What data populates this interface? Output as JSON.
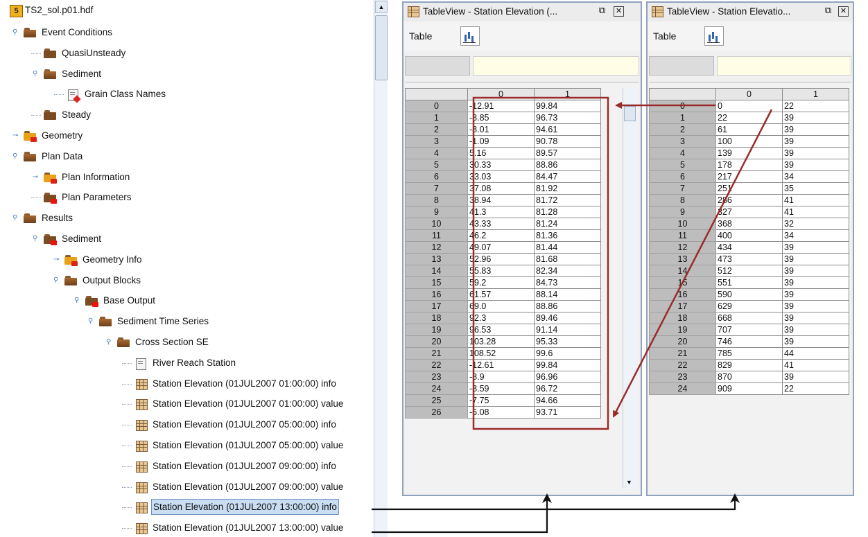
{
  "tree": {
    "root": "TS2_sol.p01.hdf",
    "items": [
      {
        "label": "Event Conditions",
        "icon": "folder-open-icon"
      },
      {
        "label": "QuasiUnsteady",
        "icon": "folder-icon"
      },
      {
        "label": "Sediment",
        "icon": "folder-open-icon"
      },
      {
        "label": "Grain Class Names",
        "icon": "dataset-icon"
      },
      {
        "label": "Steady",
        "icon": "folder-icon"
      },
      {
        "label": "Geometry",
        "icon": "folder-special-icon"
      },
      {
        "label": "Plan Data",
        "icon": "folder-open-icon"
      },
      {
        "label": "Plan Information",
        "icon": "folder-special-icon"
      },
      {
        "label": "Plan Parameters",
        "icon": "folder-red-icon"
      },
      {
        "label": "Results",
        "icon": "folder-open-icon"
      },
      {
        "label": "Sediment",
        "icon": "folder-red-icon"
      },
      {
        "label": "Geometry Info",
        "icon": "folder-special-icon"
      },
      {
        "label": "Output Blocks",
        "icon": "folder-open-icon"
      },
      {
        "label": "Base Output",
        "icon": "folder-red-icon"
      },
      {
        "label": "Sediment Time Series",
        "icon": "folder-open-icon"
      },
      {
        "label": "Cross Section SE",
        "icon": "folder-open-icon"
      },
      {
        "label": "River Reach Station",
        "icon": "document-icon"
      },
      {
        "label": "Station Elevation (01JUL2007 01:00:00) info",
        "icon": "table-icon"
      },
      {
        "label": "Station Elevation (01JUL2007 01:00:00) value",
        "icon": "table-icon"
      },
      {
        "label": "Station Elevation (01JUL2007 05:00:00) info",
        "icon": "table-icon"
      },
      {
        "label": "Station Elevation (01JUL2007 05:00:00) value",
        "icon": "table-icon"
      },
      {
        "label": "Station Elevation (01JUL2007 09:00:00) info",
        "icon": "table-icon"
      },
      {
        "label": "Station Elevation (01JUL2007 09:00:00) value",
        "icon": "table-icon"
      },
      {
        "label": "Station Elevation (01JUL2007 13:00:00) info",
        "icon": "table-icon"
      },
      {
        "label": "Station Elevation (01JUL2007 13:00:00) value",
        "icon": "table-icon"
      }
    ],
    "selected_index": 23
  },
  "window1": {
    "title": "TableView  -  Station Elevation (...",
    "menu_label": "Table",
    "columns": [
      "0",
      "1"
    ],
    "rows": [
      [
        "0",
        "-12.91",
        "99.84"
      ],
      [
        "1",
        "-8.85",
        "96.73"
      ],
      [
        "2",
        "-8.01",
        "94.61"
      ],
      [
        "3",
        "-1.09",
        "90.78"
      ],
      [
        "4",
        "5.16",
        "89.57"
      ],
      [
        "5",
        "30.33",
        "88.86"
      ],
      [
        "6",
        "33.03",
        "84.47"
      ],
      [
        "7",
        "37.08",
        "81.92"
      ],
      [
        "8",
        "38.94",
        "81.72"
      ],
      [
        "9",
        "41.3",
        "81.28"
      ],
      [
        "10",
        "43.33",
        "81.24"
      ],
      [
        "11",
        "46.2",
        "81.36"
      ],
      [
        "12",
        "49.07",
        "81.44"
      ],
      [
        "13",
        "52.96",
        "81.68"
      ],
      [
        "14",
        "55.83",
        "82.34"
      ],
      [
        "15",
        "59.2",
        "84.73"
      ],
      [
        "16",
        "61.57",
        "88.14"
      ],
      [
        "17",
        "69.0",
        "88.86"
      ],
      [
        "18",
        "92.3",
        "89.46"
      ],
      [
        "19",
        "96.53",
        "91.14"
      ],
      [
        "20",
        "103.28",
        "95.33"
      ],
      [
        "21",
        "108.52",
        "99.6"
      ],
      [
        "22",
        "-12.61",
        "99.84"
      ],
      [
        "23",
        "-8.9",
        "96.96"
      ],
      [
        "24",
        "-8.59",
        "96.72"
      ],
      [
        "25",
        "-7.75",
        "94.66"
      ],
      [
        "26",
        "-6.08",
        "93.71"
      ]
    ]
  },
  "window2": {
    "title": "TableView  -  Station Elevatio...",
    "menu_label": "Table",
    "columns": [
      "0",
      "1"
    ],
    "rows": [
      [
        "0",
        "0",
        "22"
      ],
      [
        "1",
        "22",
        "39"
      ],
      [
        "2",
        "61",
        "39"
      ],
      [
        "3",
        "100",
        "39"
      ],
      [
        "4",
        "139",
        "39"
      ],
      [
        "5",
        "178",
        "39"
      ],
      [
        "6",
        "217",
        "34"
      ],
      [
        "7",
        "251",
        "35"
      ],
      [
        "8",
        "286",
        "41"
      ],
      [
        "9",
        "327",
        "41"
      ],
      [
        "10",
        "368",
        "32"
      ],
      [
        "11",
        "400",
        "34"
      ],
      [
        "12",
        "434",
        "39"
      ],
      [
        "13",
        "473",
        "39"
      ],
      [
        "14",
        "512",
        "39"
      ],
      [
        "15",
        "551",
        "39"
      ],
      [
        "16",
        "590",
        "39"
      ],
      [
        "17",
        "629",
        "39"
      ],
      [
        "18",
        "668",
        "39"
      ],
      [
        "19",
        "707",
        "39"
      ],
      [
        "20",
        "746",
        "39"
      ],
      [
        "21",
        "785",
        "44"
      ],
      [
        "22",
        "829",
        "41"
      ],
      [
        "23",
        "870",
        "39"
      ],
      [
        "24",
        "909",
        "22"
      ]
    ]
  },
  "colors": {
    "annotation": "#9b2a2a",
    "selection": "#c9ddf3",
    "row_header": "#bdbdbd",
    "edit_box": "#fffde6"
  }
}
